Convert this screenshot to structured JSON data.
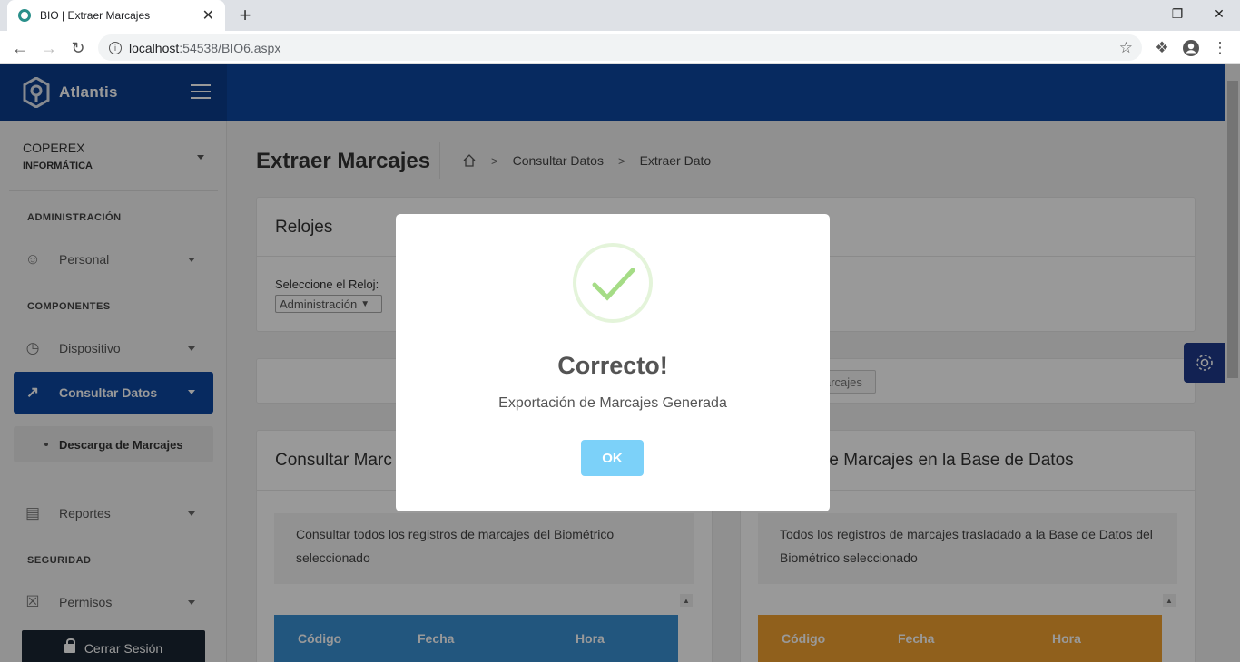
{
  "browser": {
    "tab_title": "BIO | Extraer Marcajes",
    "tab_close": "✕",
    "new_tab": "+",
    "url_host": "localhost",
    "url_rest": ":54538/BIO6.aspx"
  },
  "app": {
    "brand": "Atlantis",
    "accent": "#0d47a1"
  },
  "sidebar": {
    "company": "COPEREX",
    "company_sub": "INFORMÁTICA",
    "sections": {
      "admin": "ADMINISTRACIÓN",
      "components": "COMPONENTES",
      "security": "SEGURIDAD"
    },
    "items": {
      "personal": "Personal",
      "dispositivo": "Dispositivo",
      "consultar": "Consultar Datos",
      "descarga": "Descarga de Marcajes",
      "reportes": "Reportes",
      "permisos": "Permisos"
    },
    "logout": "Cerrar Sesión"
  },
  "main": {
    "title": "Extraer Marcajes",
    "breadcrumb": [
      "Consultar Datos",
      "Extraer Dato"
    ],
    "relojes": {
      "title": "Relojes",
      "select_label": "Seleccione el Reloj:",
      "select_value": "Administración"
    },
    "action_button_partial": "arcajes",
    "left_card": {
      "title": "Consultar Marc",
      "desc_line1": "Consultar todos los registros de marcajes del Biométrico",
      "desc_line2": "seleccionado",
      "columns": [
        "Código",
        "Fecha",
        "Hora"
      ]
    },
    "right_card": {
      "title": "s de Marcajes en la Base de Datos",
      "desc_line1": "Todos los registros de marcajes trasladado a la Base de Datos del",
      "desc_line2": "Biométrico seleccionado",
      "columns": [
        "Código",
        "Fecha",
        "Hora"
      ]
    }
  },
  "modal": {
    "title": "Correcto!",
    "message": "Exportación de Marcajes Generada",
    "ok": "OK"
  }
}
